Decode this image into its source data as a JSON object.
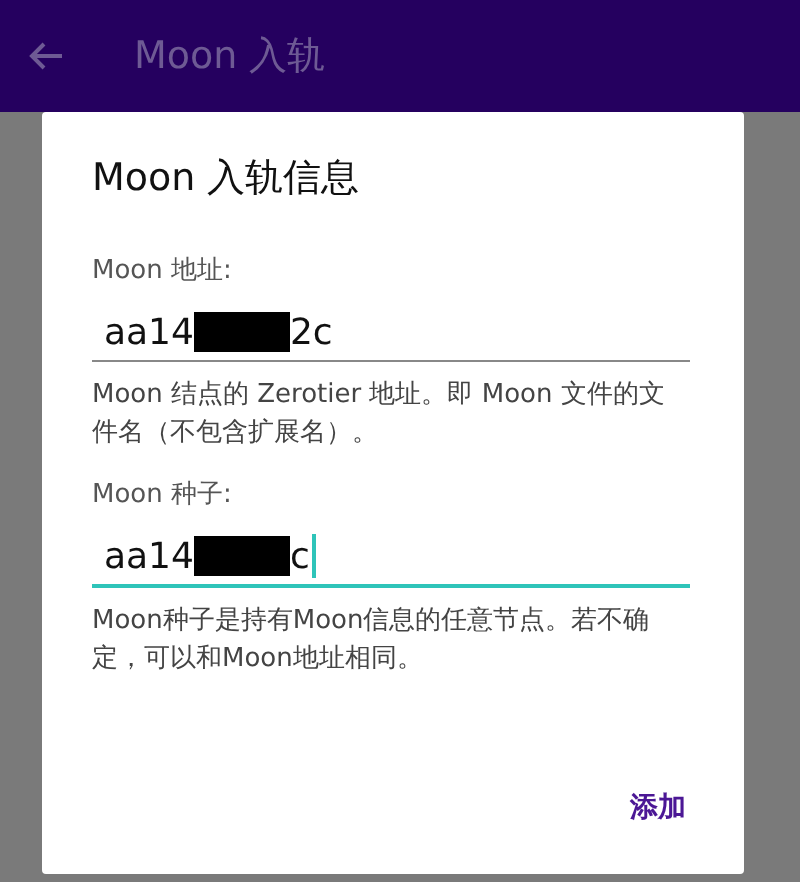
{
  "app_bar": {
    "title": "Moon 入轨"
  },
  "dialog": {
    "title": "Moon 入轨信息",
    "fields": [
      {
        "label": "Moon 地址:",
        "value_start": "aa14",
        "value_end": "2c",
        "redacted": true,
        "focused": false,
        "helper": "Moon 结点的 Zerotier 地址。即 Moon 文件的文件名（不包含扩展名）。"
      },
      {
        "label": "Moon 种子:",
        "value_start": "aa14",
        "value_end": "c",
        "redacted": true,
        "focused": true,
        "helper": "Moon种子是持有Moon信息的任意节点。若不确定，可以和Moon地址相同。"
      }
    ],
    "button": "添加"
  }
}
